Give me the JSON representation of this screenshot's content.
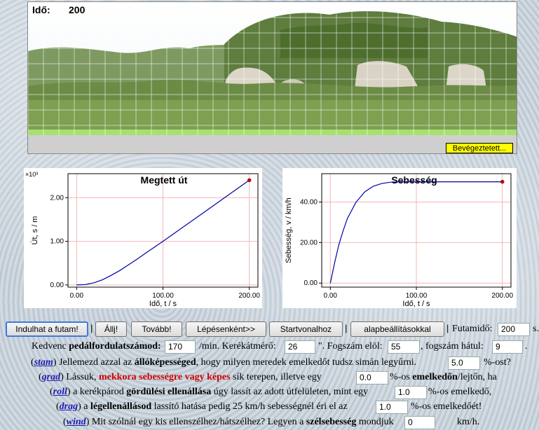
{
  "scene": {
    "time_label": "Idő:",
    "time_value": "200",
    "finished_label": "Bevégeztetett..."
  },
  "chart_data": [
    {
      "type": "line",
      "title": "Megtett út",
      "xlabel": "Idő, t / s",
      "ylabel": "Út, s / m",
      "y_multiplier_label": "×10³",
      "xlim": [
        -10,
        210
      ],
      "ylim": [
        -0.05,
        2.55
      ],
      "x_ticks": [
        "0.00",
        "100.00",
        "200.00"
      ],
      "y_ticks": [
        "0.00",
        "1.00",
        "2.00"
      ],
      "grid": true,
      "series": [
        {
          "x": [
            0,
            10,
            20,
            30,
            40,
            50,
            60,
            70,
            80,
            100,
            120,
            140,
            160,
            180,
            200
          ],
          "values": [
            0,
            0.01,
            0.05,
            0.12,
            0.22,
            0.33,
            0.46,
            0.59,
            0.73,
            1.0,
            1.28,
            1.56,
            1.84,
            2.12,
            2.4
          ]
        }
      ],
      "endpoint": {
        "x": 200,
        "y": 2.4
      }
    },
    {
      "type": "line",
      "title": "Sebesség",
      "xlabel": "Idő, t / s",
      "ylabel": "Sebesség, v / km/h",
      "xlim": [
        -10,
        210
      ],
      "ylim": [
        -2,
        54
      ],
      "x_ticks": [
        "0.00",
        "100.00",
        "200.00"
      ],
      "y_ticks": [
        "0.00",
        "20.00",
        "40.00"
      ],
      "grid": true,
      "series": [
        {
          "x": [
            0,
            5,
            10,
            15,
            20,
            30,
            40,
            50,
            60,
            70,
            80,
            100,
            150,
            200
          ],
          "values": [
            0,
            10,
            19,
            26,
            32,
            40,
            45,
            47.8,
            49.2,
            49.8,
            50,
            50,
            50,
            50
          ]
        }
      ],
      "endpoint": {
        "x": 200,
        "y": 50
      }
    }
  ],
  "controls": {
    "start": "Indulhat a futam!",
    "stop": "Állj!",
    "resume": "Tovább!",
    "step": "Lépésenként>>",
    "reset_line": "Startvonalhoz",
    "defaults": "alapbeállításokkal",
    "runtime_label": "Futamidő:",
    "runtime_value": "200",
    "runtime_unit": "s."
  },
  "form": {
    "cadence_pre": "Kedvenc ",
    "cadence_bold": "pedálfordulatszámod:",
    "cadence_value": "170",
    "cadence_unit": "/min. Kerékátmérő:",
    "wheel_value": "26",
    "wheel_unit": "\". Fogszám elöl:",
    "front_teeth": "55",
    "rear_label": ", fogszám hátul:",
    "rear_teeth": "9",
    "rear_end": ".",
    "stam_kw": "stam",
    "stam_pre": " Jellemezd azzal az ",
    "stam_bold": "állóképességed",
    "stam_post": ", hogy milyen meredek emelkedőt tudsz simán legyűrni.",
    "stam_value": "5.0",
    "stam_unit": "%-ost?",
    "grad_kw": "grad",
    "grad_pre": " Lássuk, ",
    "grad_red": "mekkora sebességre vagy képes",
    "grad_mid": " sík terepen, illetve egy",
    "grad_value": "0.0",
    "grad_unit_pre": "%-os ",
    "grad_bold": "emelkedőn",
    "grad_post": "/lejtőn, ha",
    "roll_kw": "roll",
    "roll_pre": " a kerékpárod ",
    "roll_bold": "gördülési ellenállása",
    "roll_post": " úgy lassít az adott útfelületen, mint egy",
    "roll_value": "1.0",
    "roll_unit": "%-os emelkedő,",
    "drag_kw": "drag",
    "drag_pre": " a ",
    "drag_bold": "légellenállásod",
    "drag_post": " lassító hatása pedig 25 km/h sebességnél éri el az",
    "drag_value": "1.0",
    "drag_unit": "%-os emelkedőét!",
    "wind_kw": "wind",
    "wind_pre": " Mit szólnál egy kis ellenszélhez/hátszélhez? Legyen a ",
    "wind_bold": "szélsebesség",
    "wind_post": " mondjuk",
    "wind_value": "0",
    "wind_unit": "km/h."
  }
}
